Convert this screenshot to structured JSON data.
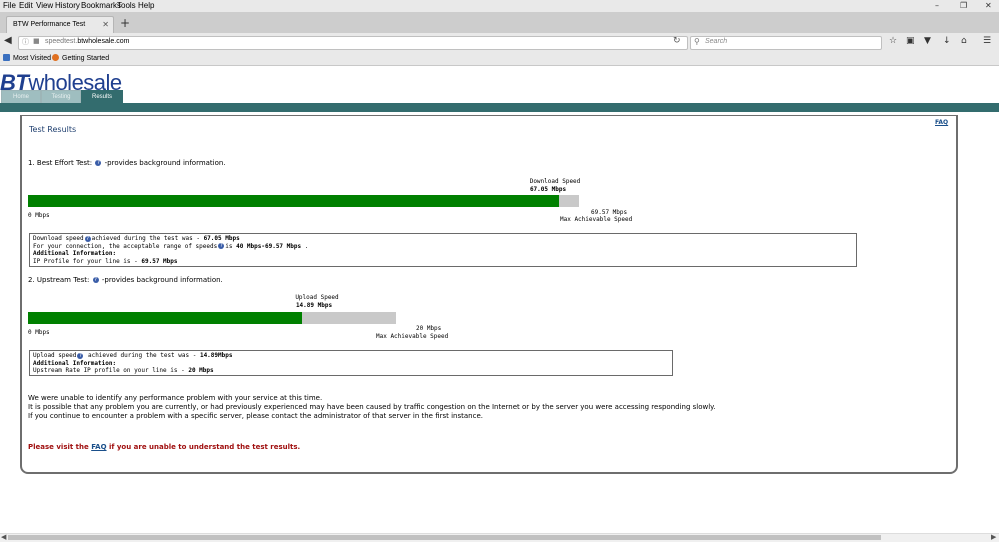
{
  "browser": {
    "menu": [
      "File",
      "Edit",
      "View",
      "History",
      "Bookmarks",
      "Tools",
      "Help"
    ],
    "tab_title": "BTW Performance Test",
    "url_gray": "speedtest.",
    "url_domain": "btwholesale.com",
    "search_placeholder": "Search",
    "bookmarks": [
      "Most Visited",
      "Getting Started"
    ]
  },
  "header": {
    "logo_bt": "BT",
    "logo_rest": "wholesale",
    "tabs": [
      "Home",
      "Testing",
      "Results"
    ]
  },
  "results": {
    "title": "Test Results",
    "faq_link": "FAQ",
    "best_effort": {
      "label_prefix": "1. Best Effort Test:",
      "label_suffix": "-provides background information.",
      "bar_caption": "Download Speed",
      "bar_value": "67.05 Mbps",
      "min_label": "0 Mbps",
      "max_value": "69.57 Mbps",
      "max_caption": "Max Achievable Speed",
      "progress": 0.9638,
      "info_line1_a": "Download speed",
      "info_line1_b": "achieved during the test was - ",
      "info_line1_val": "67.05 Mbps",
      "info_line2_a": "For your connection, the acceptable range of speeds",
      "info_line2_b": "is ",
      "info_line2_val": "40 Mbps-69.57 Mbps",
      "info_line2_c": " .",
      "info_line3": "Additional Information:",
      "info_line4_a": "IP Profile for your line is - ",
      "info_line4_val": "69.57 Mbps"
    },
    "upstream": {
      "label_prefix": "2. Upstream Test:",
      "label_suffix": "-provides background information.",
      "bar_caption": "Upload Speed",
      "bar_value": "14.89 Mbps",
      "min_label": "0 Mbps",
      "max_value": "20 Mbps",
      "max_caption": "Max Achievable Speed",
      "progress": 0.7445,
      "info_line1_a": "Upload speed",
      "info_line1_b": " achieved during the test was - ",
      "info_line1_val": "14.89Mbps",
      "info_line2": "Additional Information:",
      "info_line3_a": "Upstream Rate IP profile on your line is - ",
      "info_line3_val": "20 Mbps"
    },
    "message": [
      "We were unable to identify any performance problem with your service at this time.",
      "It is possible that any problem you are currently, or had previously experienced may have been caused by traffic congestion on the Internet or by the server you were accessing responding slowly.",
      "If you continue to encounter a problem with a specific server, please contact the administrator of that server in the first instance."
    ],
    "visit_a": "Please visit the ",
    "visit_faq": "FAQ",
    "visit_b": " if you are unable to understand the test results."
  },
  "colors": {
    "bar_fill": "#008000",
    "bar_track": "#c9c9c9",
    "teal_bar": "#336c6e",
    "logo": "#1f3f8f",
    "alert": "#a01010"
  },
  "icons": [
    "back-arrow-icon",
    "info-icon",
    "lock-icon",
    "reload-icon",
    "search-icon",
    "star-icon",
    "clipboard-icon",
    "pocket-icon",
    "download-icon",
    "home-icon",
    "hamburger-menu-icon",
    "help-icon",
    "close-icon",
    "new-tab-icon",
    "minimize-icon",
    "maximize-icon",
    "window-close-icon"
  ]
}
